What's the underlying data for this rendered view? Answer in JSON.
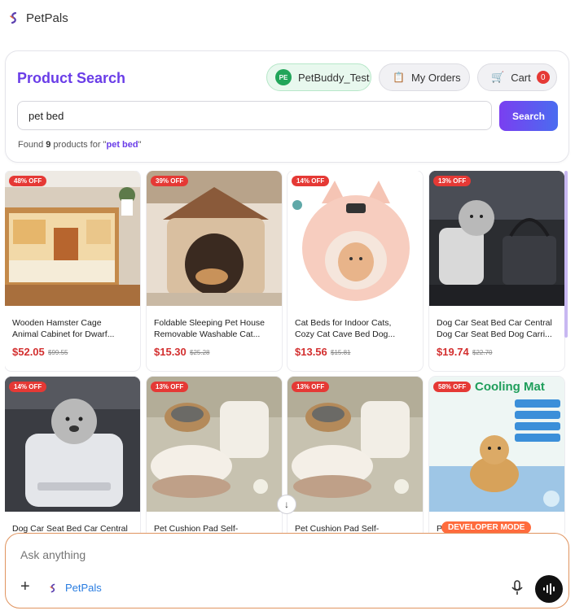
{
  "app": {
    "name": "PetPals"
  },
  "header": {
    "title": "Product Search",
    "user": {
      "initials": "PE",
      "name": "PetBuddy_Test"
    },
    "orders_label": "My Orders",
    "cart_label": "Cart",
    "cart_count": "0"
  },
  "search": {
    "value": "pet bed",
    "button_label": "Search",
    "found_prefix": "Found ",
    "found_count": "9",
    "found_middle": " products for \"",
    "found_query": "pet bed",
    "found_suffix": "\""
  },
  "products": [
    {
      "discount": "48% OFF",
      "name": "Wooden Hamster Cage\nAnimal Cabinet for Dwarf...",
      "price": "$52.05",
      "old_price": "$99.55"
    },
    {
      "discount": "39% OFF",
      "name": "Foldable Sleeping Pet House\nRemovable Washable Cat...",
      "price": "$15.30",
      "old_price": "$25.28"
    },
    {
      "discount": "14% OFF",
      "name": "Cat Beds for Indoor Cats,\nCozy Cat Cave Bed Dog...",
      "price": "$13.56",
      "old_price": "$15.81"
    },
    {
      "discount": "13% OFF",
      "name": "Dog Car Seat Bed Car Central\nDog Car Seat Bed Dog Carri...",
      "price": "$19.74",
      "old_price": "$22.70"
    },
    {
      "discount": "14% OFF",
      "name": "Dog Car Seat Bed Car Central",
      "price": "",
      "old_price": ""
    },
    {
      "discount": "13% OFF",
      "name": "Pet Cushion Pad Self-",
      "price": "",
      "old_price": ""
    },
    {
      "discount": "13% OFF",
      "name": "Pet Cushion Pad Self-",
      "price": "",
      "old_price": ""
    },
    {
      "discount": "58% OFF",
      "name": "P",
      "price": "",
      "old_price": "",
      "image_text": "Cooling Mat"
    }
  ],
  "developer_badge": "DEVELOPER MODE",
  "composer": {
    "placeholder": "Ask anything",
    "app_label": "PetPals"
  },
  "icons": {
    "logo": "petpals-logo-icon",
    "orders": "clipboard-icon",
    "cart": "cart-icon",
    "scroll_down": "arrow-down-icon",
    "plus": "plus-icon",
    "mic": "microphone-icon",
    "voice": "voice-waveform-icon"
  },
  "colors": {
    "accent": "#6a3de8",
    "discount": "#e53935",
    "price": "#d32f2f",
    "composer_border": "#e0945f"
  }
}
